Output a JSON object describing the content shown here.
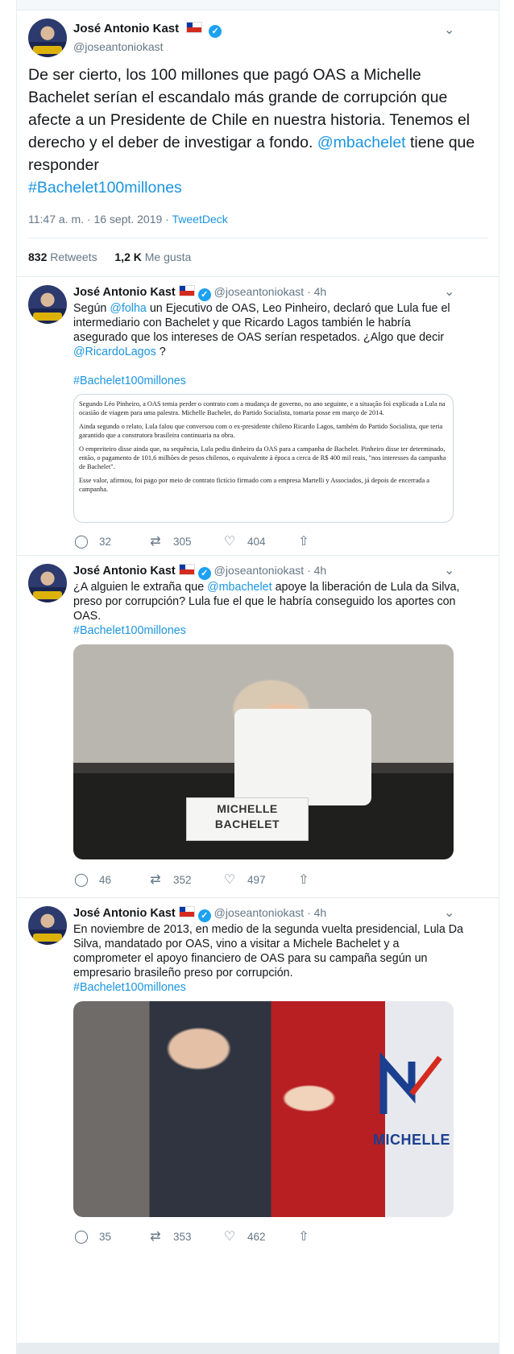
{
  "main_tweet": {
    "author": "José Antonio Kast",
    "handle": "@joseantoniokast",
    "text_part1": "De ser cierto, los 100 millones que pagó OAS a Michelle Bachelet serían el escandalo más grande de corrupción que afecte a un Presidente de Chile en nuestra historia. Tenemos el derecho y el deber de investigar a fondo. ",
    "mention": "@mbachelet",
    "text_part2": " tiene que responder",
    "hashtag": "#Bachelet100millones",
    "time": "11:47 a. m. · 16 sept. 2019 · ",
    "source": "TweetDeck",
    "retweets_count": "832",
    "retweets_label": "Retweets",
    "likes_count": "1,2 K",
    "likes_label": "Me gusta"
  },
  "tweets": [
    {
      "author": "José Antonio Kast",
      "handle": "@joseantoniokast",
      "age": "4h",
      "t1": "Según ",
      "m1": "@folha",
      "t2": " un Ejecutivo de OAS, Leo Pinheiro, declaró que Lula fue el intermediario con Bachelet y que Ricardo Lagos también le habría asegurado que los intereses de OAS serían respetados. ¿Algo que decir ",
      "m2": "@RicardoLagos",
      "t3": " ?",
      "hashtag": "#Bachelet100millones",
      "quote": [
        "Segundo Léo Pinheiro, a OAS temia perder o contrato com a mudança de governo, no ano seguinte, e a situação foi explicada a Lula na ocasião de viagem para uma palestra. Michelle Bachelet, do Partido Socialista, tomaria posse em março de 2014.",
        "Ainda segundo o relato, Lula falou que conversou com o ex-presidente chileno Ricardo Lagos, também do Partido Socialista, que teria garantido que a construtora brasileira continuaria na obra.",
        "O empreiteiro disse ainda que, na sequência, Lula pediu dinheiro da OAS para a campanha de Bachelet. Pinheiro disse ter determinado, então, o pagamento de 101,6 milhões de pesos chilenos, o equivalente à época a cerca de R$ 400 mil reais, \"nos interesses da campanha de Bachelet\".",
        "Esse valor, afirmou, foi pago por meio de contrato fictício firmado com a empresa Martelli y Associados, já depois de encerrada a campanha."
      ],
      "replies": "32",
      "retweets": "305",
      "likes": "404"
    },
    {
      "author": "José Antonio Kast",
      "handle": "@joseantoniokast",
      "age": "4h",
      "t1": "¿A alguien le extraña que ",
      "m1": "@mbachelet",
      "t2": " apoye la liberación de Lula da Silva, preso por corrupción? Lula fue el que le habría conseguido los aportes con OAS.",
      "hashtag": "#Bachelet100millones",
      "photo_text": "MICHELLE BACHELET",
      "replies": "46",
      "retweets": "352",
      "likes": "497"
    },
    {
      "author": "José Antonio Kast",
      "handle": "@joseantoniokast",
      "age": "4h",
      "t1": "En noviembre de 2013, en medio de la segunda vuelta presidencial, Lula Da Silva, mandatado por OAS, vino a visitar a Michele Bachelet y a comprometer el apoyo financiero de OAS para su campaña según un empresario brasileño preso por corrupción.",
      "hashtag": "#Bachelet100millones",
      "photo_text": "MICHELLE",
      "replies": "35",
      "retweets": "353",
      "likes": "462"
    }
  ],
  "icons": {
    "reply": "reply-icon",
    "retweet": "retweet-icon",
    "like": "heart-icon",
    "share": "share-icon",
    "verified": "verified-icon",
    "flag": "chile-flag-icon",
    "caret": "chevron-down-icon"
  },
  "colors": {
    "link": "#1b95e0",
    "muted": "#657786",
    "verified": "#1da1f2"
  }
}
